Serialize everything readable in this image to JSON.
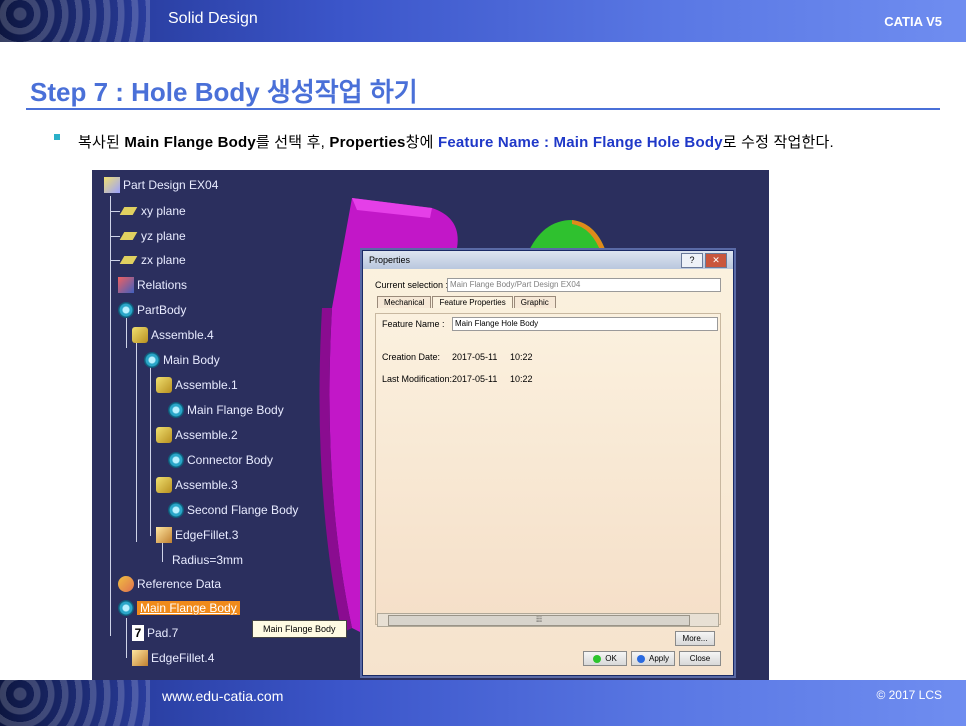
{
  "header": {
    "title": "Solid Design",
    "brand": "CATIA V5"
  },
  "step_title": "Step 7 : Hole Body 생성작업 하기",
  "instruction": {
    "p1": "복사된 ",
    "b1": "Main Flange  Body",
    "p2": "를 선택 후, ",
    "b2": "Properties",
    "p3": "창에 ",
    "blue1": "Feature Name : Main Flange Hole Body",
    "p4": "로 수정 작업한다."
  },
  "tree": {
    "root": "Part Design EX04",
    "items": {
      "xy": "xy plane",
      "yz": "yz plane",
      "zx": "zx plane",
      "relations": "Relations",
      "partbody": "PartBody",
      "assemble4": "Assemble.4",
      "mainbody": "Main Body",
      "assemble1": "Assemble.1",
      "mainflange": "Main Flange Body",
      "assemble2": "Assemble.2",
      "connector": "Connector Body",
      "assemble3": "Assemble.3",
      "secondflange": "Second Flange Body",
      "edgefillet3": "EdgeFillet.3",
      "radius": "Radius=3mm",
      "refdata": "Reference Data",
      "mainflange_sel": "Main Flange Body",
      "pad": "Pad.7",
      "edgefillet4": "EdgeFillet.4"
    },
    "tooltip": "Main Flange Body"
  },
  "dialog": {
    "title": "Properties",
    "current_selection_label": "Current selection :",
    "current_selection_value": "Main Flange Body/Part Design EX04",
    "tabs": [
      "Mechanical",
      "Feature Properties",
      "Graphic"
    ],
    "feature_name_label": "Feature Name :",
    "feature_name_value": "Main Flange Hole Body",
    "creation_date_label": "Creation Date:",
    "creation_date_value": "2017-05-11",
    "creation_time": "10:22",
    "last_mod_label": "Last Modification:",
    "last_mod_value": "2017-05-11",
    "last_mod_time": "10:22",
    "more_button": "More...",
    "ok_button": "OK",
    "apply_button": "Apply",
    "close_button": "Close",
    "help_icon": "?",
    "close_icon": "✕"
  },
  "footer": {
    "url": "www.edu-catia.com",
    "copyright": "© 2017 LCS"
  }
}
